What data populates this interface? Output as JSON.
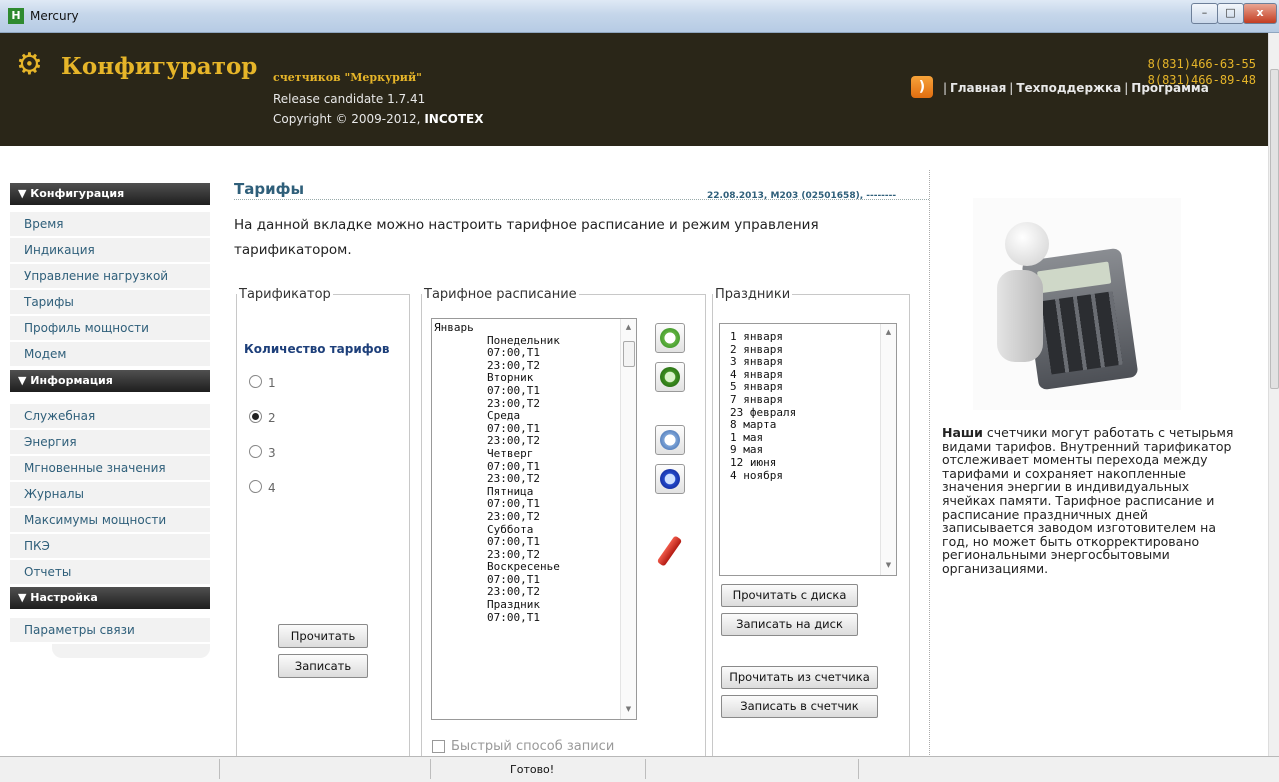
{
  "window": {
    "title": "Mercury",
    "icon": "H",
    "minimize": "–",
    "maximize": "□",
    "close": "x"
  },
  "header": {
    "brand_title": "Конфигуратор",
    "brand_subtitle": "счетчиков \"Меркурий\"",
    "release": "Release candidate 1.7.41",
    "copyright_prefix": "Copyright © 2009-2012,",
    "copyright_company": "INCOTEX",
    "phone1": "8(831)466-63-55",
    "phone2": "8(831)466-89-48",
    "nav": [
      "Главная",
      "Техподдержка",
      "Программа"
    ],
    "icons": {
      "logo": "gear-icon",
      "rss": "rss-icon"
    }
  },
  "sidebar": {
    "sections": [
      {
        "title": "▼ Конфигурация",
        "items": [
          "Время",
          "Индикация",
          "Управление нагрузкой",
          "Тарифы",
          "Профиль мощности",
          "Модем"
        ]
      },
      {
        "title": "▼ Информация",
        "items": [
          "Служебная",
          "Энергия",
          "Мгновенные значения",
          "Журналы",
          "Максимумы мощности",
          "ПКЭ",
          "Отчеты"
        ]
      },
      {
        "title": "▼ Настройка",
        "items": [
          "Параметры связи"
        ]
      }
    ]
  },
  "main": {
    "title": "Тарифы",
    "device_info": "22.08.2013, M203 (02501658), --------",
    "intro": "На данной вкладке можно настроить тарифное расписание и режим управления тарификатором.",
    "tariffer": {
      "legend": "Тарификатор",
      "count_label": "Количество тарифов",
      "options": [
        "1",
        "2",
        "3",
        "4"
      ],
      "selected": "2",
      "read_button": "Прочитать",
      "write_button": "Записать"
    },
    "schedule": {
      "legend": "Тарифное расписание",
      "lines": [
        "Январь",
        "        Понедельник",
        "        07:00,T1",
        "        23:00,T2",
        "        Вторник",
        "        07:00,T1",
        "        23:00,T2",
        "        Среда",
        "        07:00,T1",
        "        23:00,T2",
        "        Четверг",
        "        07:00,T1",
        "        23:00,T2",
        "        Пятница",
        "        07:00,T1",
        "        23:00,T2",
        "        Суббота",
        "        07:00,T1",
        "        23:00,T2",
        "        Воскресенье",
        "        07:00,T1",
        "        23:00,T2",
        "        Праздник",
        "        07:00,T1"
      ],
      "fast_write_label": "Быстрый способ записи",
      "fast_write_checked": false,
      "tool_icons": [
        "clock-add-icon",
        "clock-refresh-icon",
        "clock-remove-icon",
        "clock-history-icon",
        "pen-edit-icon"
      ]
    },
    "holidays": {
      "legend": "Праздники",
      "items": [
        "1 января",
        "2 января",
        "3 января",
        "4 января",
        "5 января",
        "7 января",
        "23 февраля",
        "8 марта",
        "1 мая",
        "9 мая",
        "12 июня",
        "4 ноября"
      ],
      "read_disk": "Прочитать с диска",
      "write_disk": "Записать на диск",
      "read_meter": "Прочитать из счетчика",
      "write_meter": "Записать в счетчик"
    }
  },
  "info_panel": {
    "image": "calculator-man-icon",
    "bold_lead": "Наши",
    "text": "счетчики могут работать с четырьмя видами тарифов. Внутренний тарификатор отслеживает моменты перехода между тарифами и сохраняет накопленные значения энергии в индивидуальных ячейках памяти. Тарифное расписание и расписание праздничных дней записывается заводом изготовителем на год, но может быть откорректировано региональными энергосбытовыми организациями."
  },
  "status": {
    "text": "Готово!"
  },
  "colors": {
    "header_bg": "#2a2618",
    "brand_gold": "#e6b529",
    "link_teal": "#2f5f7a",
    "sidebar_head": "#2b2b2b"
  }
}
